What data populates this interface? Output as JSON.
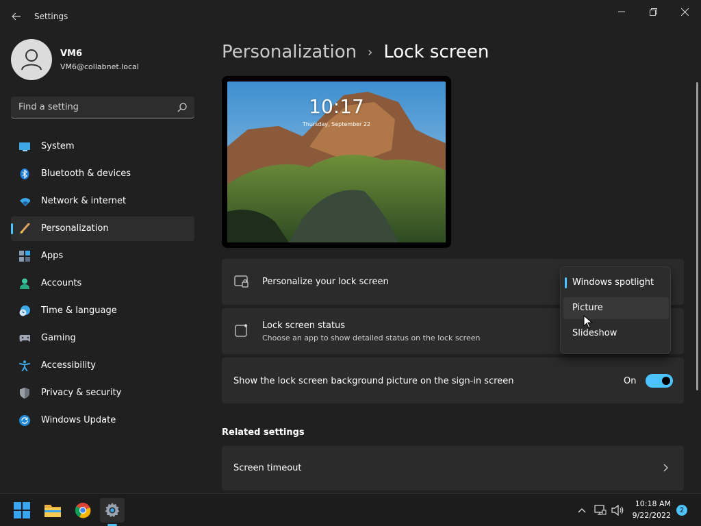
{
  "window": {
    "title": "Settings"
  },
  "user": {
    "name": "VM6",
    "email": "VM6@collabnet.local"
  },
  "search": {
    "placeholder": "Find a setting"
  },
  "sidebar": {
    "items": [
      {
        "label": "System",
        "icon": "system-icon"
      },
      {
        "label": "Bluetooth & devices",
        "icon": "bluetooth-icon"
      },
      {
        "label": "Network & internet",
        "icon": "wifi-icon"
      },
      {
        "label": "Personalization",
        "icon": "paintbrush-icon",
        "selected": true
      },
      {
        "label": "Apps",
        "icon": "apps-icon"
      },
      {
        "label": "Accounts",
        "icon": "person-icon"
      },
      {
        "label": "Time & language",
        "icon": "globe-clock-icon"
      },
      {
        "label": "Gaming",
        "icon": "gamepad-icon"
      },
      {
        "label": "Accessibility",
        "icon": "accessibility-icon"
      },
      {
        "label": "Privacy & security",
        "icon": "shield-icon"
      },
      {
        "label": "Windows Update",
        "icon": "update-icon"
      }
    ]
  },
  "breadcrumb": {
    "parent": "Personalization",
    "separator": "›",
    "current": "Lock screen"
  },
  "preview": {
    "time": "10:17",
    "date": "Thursday, September 22"
  },
  "settings": {
    "personalize": {
      "title": "Personalize your lock screen"
    },
    "status": {
      "title": "Lock screen status",
      "description": "Choose an app to show detailed status on the lock screen"
    },
    "signin": {
      "title": "Show the lock screen background picture on the sign-in screen",
      "toggle_label": "On"
    }
  },
  "dropdown": {
    "options": [
      "Windows spotlight",
      "Picture",
      "Slideshow"
    ],
    "selected": "Windows spotlight",
    "hovered": "Picture"
  },
  "related": {
    "title": "Related settings",
    "items": [
      {
        "label": "Screen timeout"
      }
    ]
  },
  "taskbar": {
    "apps": [
      "start-icon",
      "file-explorer-icon",
      "chrome-icon",
      "settings-icon"
    ],
    "time": "10:18 AM",
    "date": "9/22/2022",
    "notifications": "2"
  },
  "colors": {
    "accent": "#4cc2ff",
    "background": "#202020",
    "card": "#2b2b2b"
  }
}
